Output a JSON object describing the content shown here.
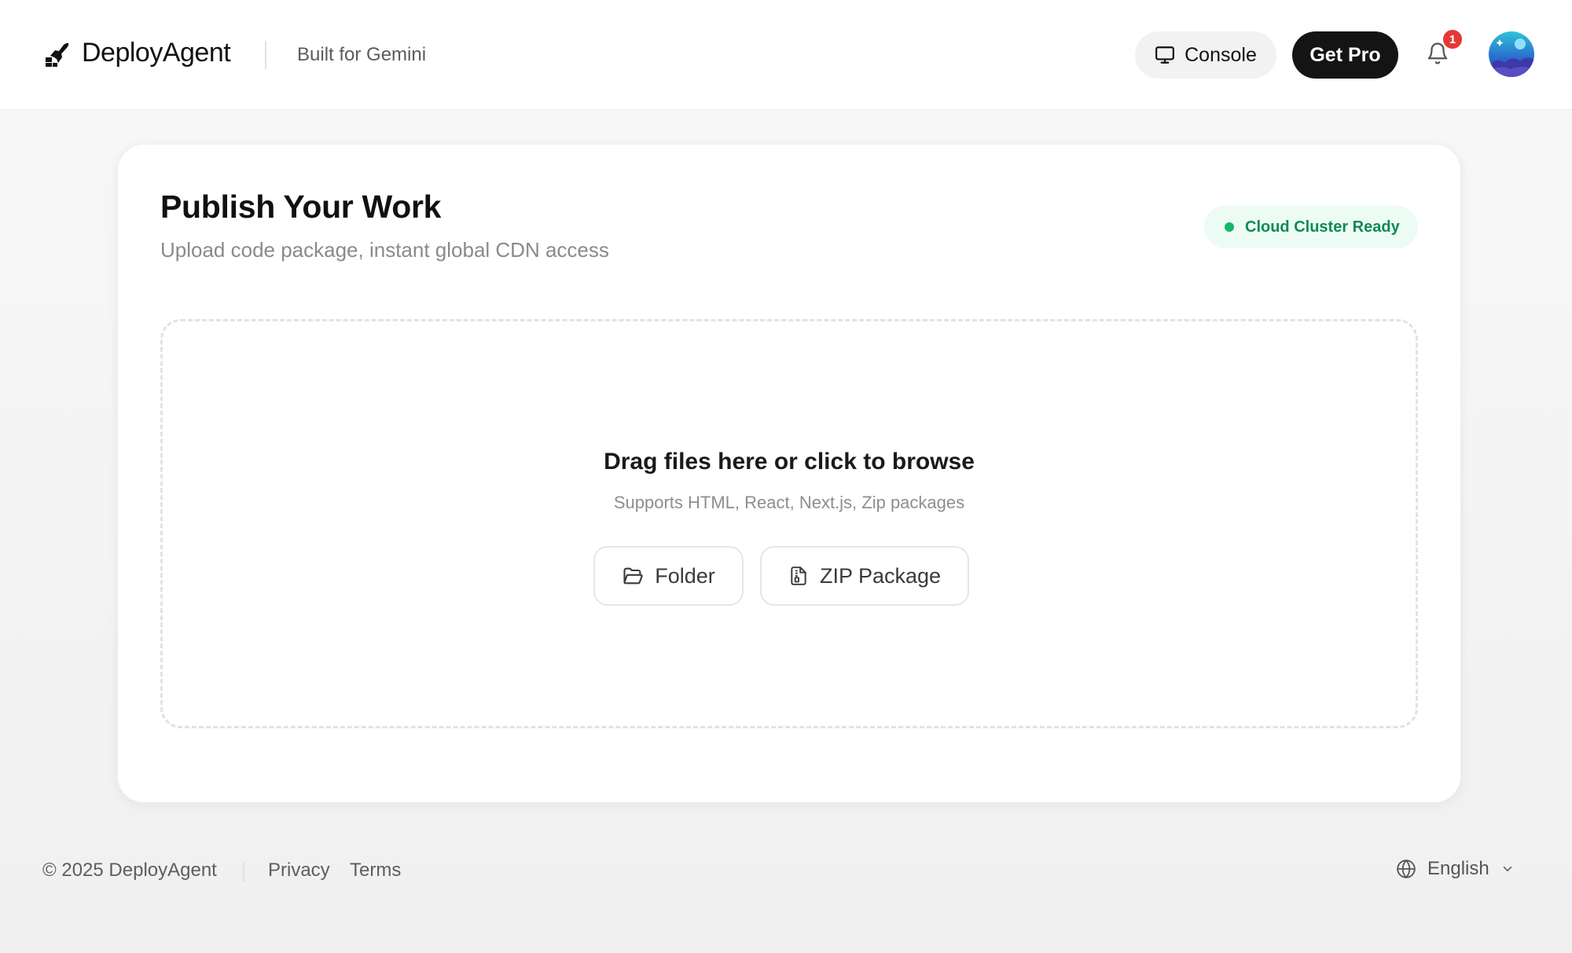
{
  "header": {
    "brand": "DeployAgent",
    "tagline": "Built for Gemini",
    "console_label": "Console",
    "get_pro_label": "Get Pro",
    "notification_count": "1",
    "logo_icon": "rocket-icon",
    "avatar_icon": "user-avatar"
  },
  "card": {
    "title": "Publish Your Work",
    "subtitle": "Upload code package, instant global CDN access",
    "status_text": "Cloud Cluster Ready",
    "status_color": "#12b76a"
  },
  "dropzone": {
    "title": "Drag files here or click to browse",
    "subtitle": "Supports HTML, React, Next.js, Zip packages",
    "folder_label": "Folder",
    "zip_label": "ZIP Package"
  },
  "footer": {
    "copyright": "© 2025 DeployAgent",
    "privacy_label": "Privacy",
    "terms_label": "Terms",
    "language": "English"
  },
  "colors": {
    "accent_dark": "#141414",
    "status_green": "#12b76a",
    "badge_red": "#e53935"
  }
}
